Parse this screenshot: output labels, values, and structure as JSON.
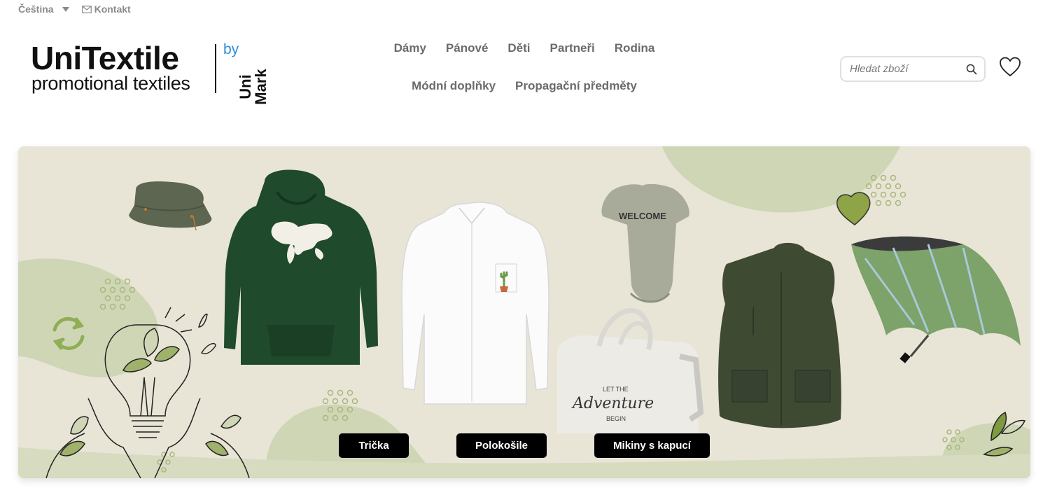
{
  "topbar": {
    "language": "Čeština",
    "contact": "Kontakt"
  },
  "logo": {
    "name": "UniTextile",
    "tagline": "promotional textiles",
    "by": "by",
    "brand_line1": "Uni",
    "brand_line2": "Mark"
  },
  "nav": {
    "items": [
      "Dámy",
      "Pánové",
      "Děti",
      "Partneři",
      "Rodina",
      "Módní doplňky",
      "Propagační předměty"
    ]
  },
  "search": {
    "placeholder": "Hledat zboží"
  },
  "hero": {
    "bag_text_1": "LET THE",
    "bag_text_2": "Adventure",
    "bag_text_3": "BEGIN",
    "onesie_text": "WELCOME",
    "buttons": [
      "Trička",
      "Polokošile",
      "Mikiny s kapucí"
    ]
  },
  "colors": {
    "accent_green": "#9fb26b",
    "blob_green": "#cfd6b6",
    "hoodie_green": "#1f4a2b",
    "vest_green": "#3f4a33"
  }
}
